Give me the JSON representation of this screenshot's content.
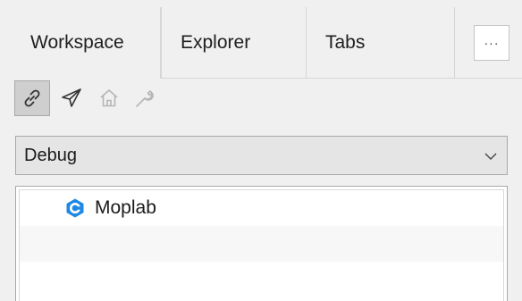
{
  "tabs": [
    {
      "label": "Workspace",
      "active": true
    },
    {
      "label": "Explorer",
      "active": false
    },
    {
      "label": "Tabs",
      "active": false
    }
  ],
  "overflow_label": "···",
  "toolbar": {
    "tools": [
      {
        "icon": "link-icon",
        "pressed": true,
        "enabled": true
      },
      {
        "icon": "send-icon",
        "pressed": false,
        "enabled": true
      },
      {
        "icon": "home-icon",
        "pressed": false,
        "enabled": false
      },
      {
        "icon": "wrench-icon",
        "pressed": false,
        "enabled": false
      }
    ]
  },
  "config_dropdown": {
    "selected": "Debug"
  },
  "tree": {
    "items": [
      {
        "label": "Moplab",
        "icon": "cpp-project-icon",
        "icon_color": "#1e88e5"
      }
    ]
  },
  "colors": {
    "accent": "#1e88e5",
    "panel_bg": "#f0f0f0"
  }
}
